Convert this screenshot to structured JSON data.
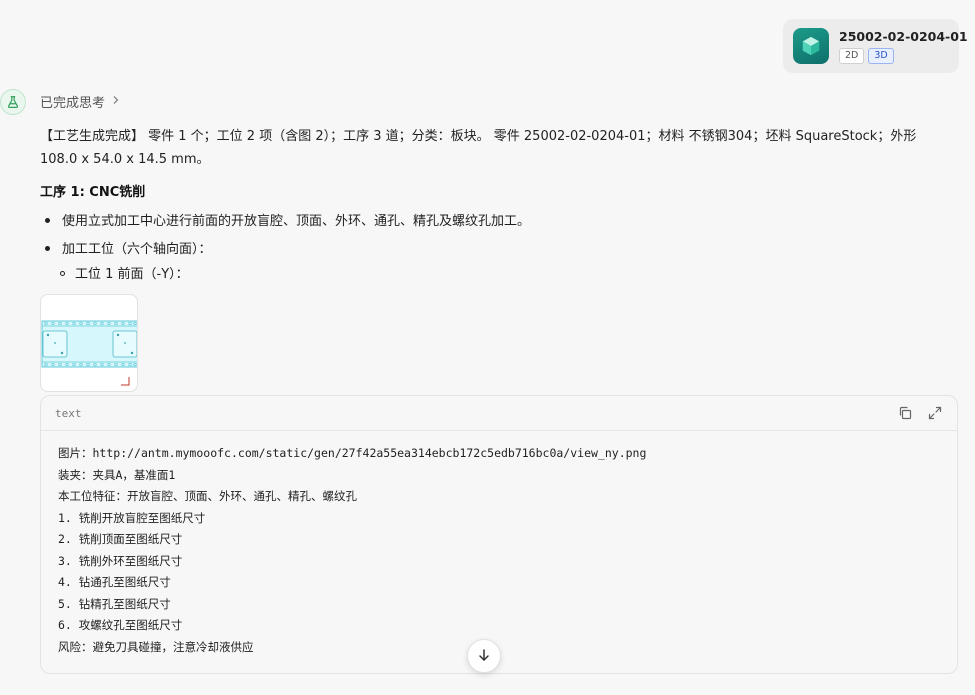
{
  "attachment": {
    "filename": "25002-02-0204-01",
    "icon": "cube-icon",
    "view_2d": "2D",
    "view_3d": "3D"
  },
  "assistant": {
    "avatar_icon": "flask-icon",
    "thinking_label": "已完成思考"
  },
  "summary": "【工艺生成完成】 零件 1 个；工位 2 项（含图 2）；工序 3 道；分类：板块。 零件 25002-02-0204-01；材料 不锈钢304；坯料 SquareStock；外形 108.0 x 54.0 x 14.5 mm。",
  "step1": {
    "title": "工序 1: CNC铣削",
    "bullet_1": "使用立式加工中心进行前面的开放盲腔、顶面、外环、通孔、精孔及螺纹孔加工。",
    "bullet_2": "加工工位（六个轴向面）：",
    "sub_bullet_1": "工位 1 前面（-Y）："
  },
  "code_block": {
    "language": "text",
    "lines": [
      "图片：http://antm.mymooofc.com/static/gen/27f42a55ea314ebcb172c5edb716bc0a/view_ny.png",
      "装夹：夹具A，基准面1",
      "本工位特征：开放盲腔、顶面、外环、通孔、精孔、螺纹孔",
      "1. 铣削开放盲腔至图纸尺寸",
      "2. 铣削顶面至图纸尺寸",
      "3. 铣削外环至图纸尺寸",
      "4. 钻通孔至图纸尺寸",
      "5. 钻精孔至图纸尺寸",
      "6. 攻螺纹孔至图纸尺寸",
      "风险：避免刀具碰撞，注意冷却液供应"
    ]
  },
  "colors": {
    "accent_blue": "#2c55c8",
    "teal": "#1b9b8a",
    "part_fill": "#d6f7fb",
    "part_stroke": "#5fc9d9"
  }
}
